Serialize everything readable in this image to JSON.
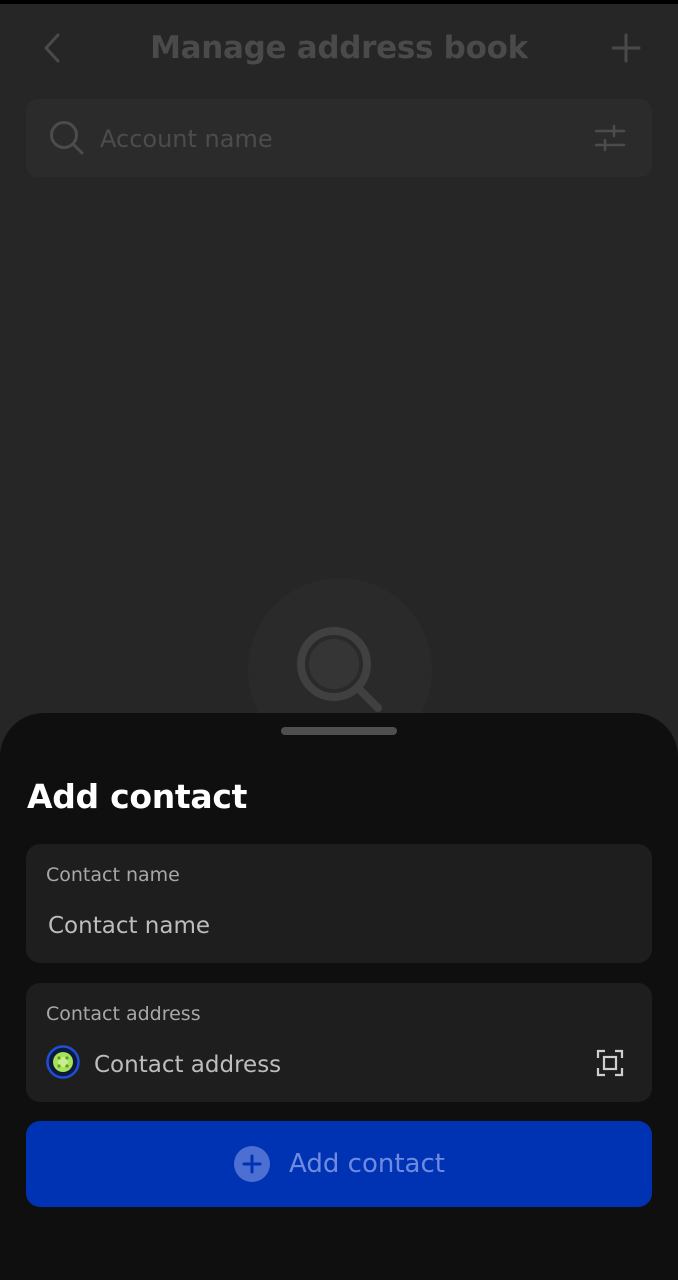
{
  "header": {
    "title": "Manage address book",
    "back_icon": "chevron-left-icon",
    "add_icon": "plus-icon"
  },
  "search": {
    "placeholder": "Account name",
    "icon": "search-icon",
    "filter_icon": "sliders-icon"
  },
  "empty_state": {
    "icon": "search-icon"
  },
  "sheet": {
    "title": "Add contact",
    "name_field": {
      "label": "Contact name",
      "placeholder": "Contact name"
    },
    "address_field": {
      "label": "Contact address",
      "placeholder": "Contact address",
      "network_icon": "network-logo-icon",
      "scan_icon": "scan-qr-icon"
    },
    "submit": {
      "label": "Add contact",
      "icon": "plus-circle-icon"
    }
  },
  "colors": {
    "background": "#262626",
    "sheet": "#0f0f0f",
    "field": "#1e1e1e",
    "accent": "#0033b3"
  }
}
